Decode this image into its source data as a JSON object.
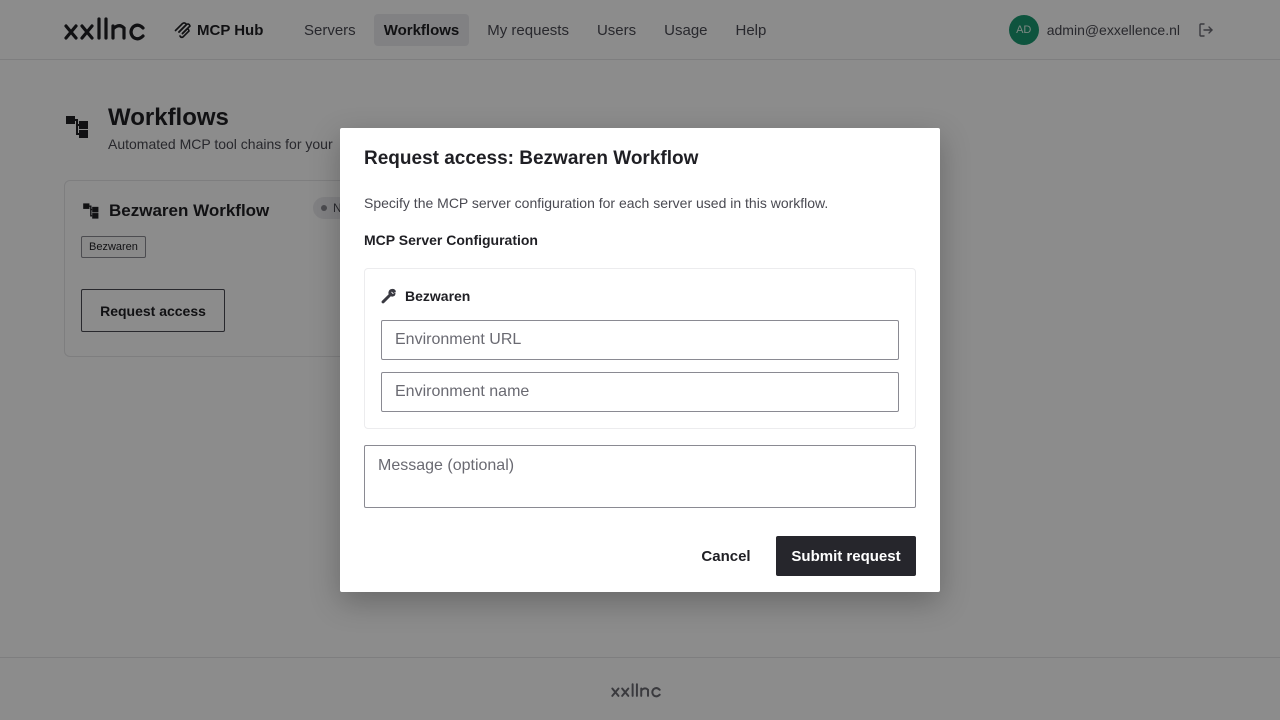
{
  "header": {
    "logo_text": "xxllnc",
    "product_name": "MCP Hub",
    "nav": [
      {
        "label": "Servers",
        "active": false
      },
      {
        "label": "Workflows",
        "active": true
      },
      {
        "label": "My requests",
        "active": false
      },
      {
        "label": "Users",
        "active": false
      },
      {
        "label": "Usage",
        "active": false
      },
      {
        "label": "Help",
        "active": false
      }
    ],
    "user": {
      "initials": "AD",
      "email": "admin@exxellence.nl",
      "avatar_color": "#1a9a72",
      "logout_icon": "logout-icon"
    }
  },
  "page": {
    "title": "Workflows",
    "subtitle": "Automated MCP tool chains for your",
    "icon": "workflow-icon"
  },
  "workflow_card": {
    "title": "Bezwaren Workflow",
    "status": "N",
    "tag": "Bezwaren",
    "button_label": "Request access"
  },
  "modal": {
    "title": "Request access: Bezwaren Workflow",
    "description": "Specify the MCP server configuration for each server used in this workflow.",
    "section_label": "MCP Server Configuration",
    "server": {
      "name": "Bezwaren",
      "icon": "wrench-icon",
      "url_placeholder": "Environment URL",
      "name_placeholder": "Environment name"
    },
    "message_placeholder": "Message (optional)",
    "cancel_label": "Cancel",
    "submit_label": "Submit request"
  },
  "footer": {
    "logo_text": "xxllnc"
  },
  "colors": {
    "primary_button": "#26262c",
    "avatar": "#1a9a72",
    "overlay": "rgba(0,0,0,0.45)"
  }
}
